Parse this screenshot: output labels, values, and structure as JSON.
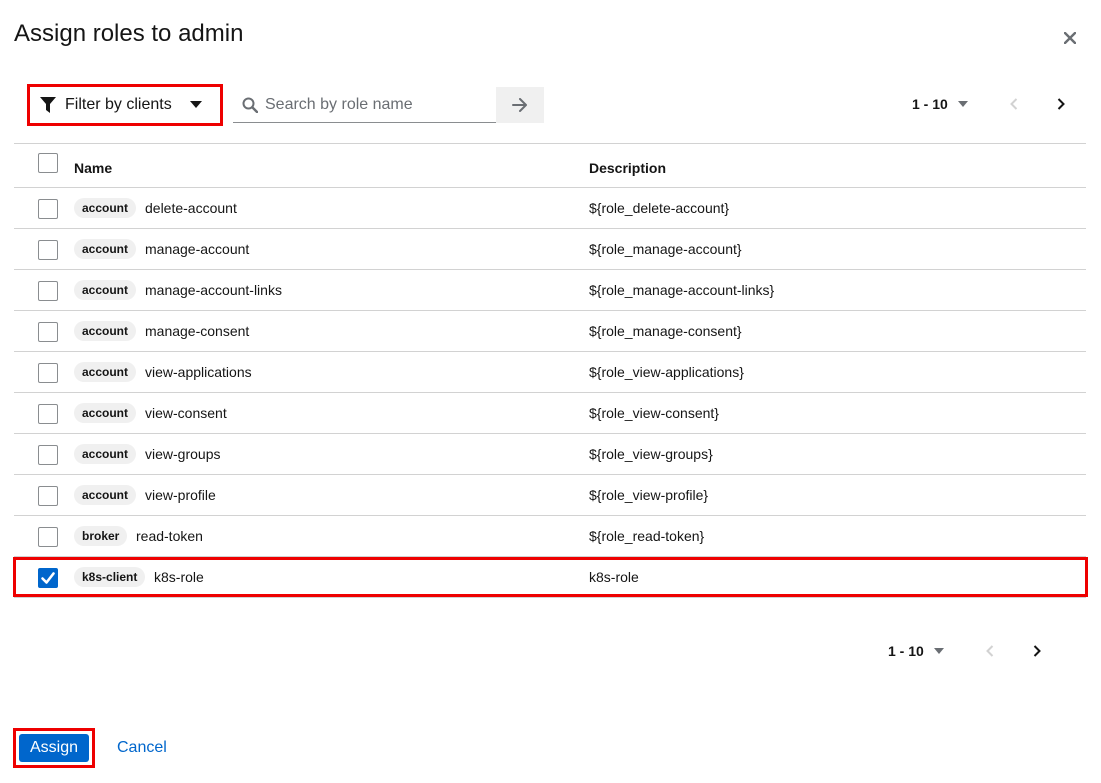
{
  "modal": {
    "title": "Assign roles to admin"
  },
  "toolbar": {
    "filter_label": "Filter by clients",
    "search_placeholder": "Search by role name",
    "pagination_range": "1 - 10"
  },
  "table": {
    "columns": [
      "Name",
      "Description"
    ],
    "rows": [
      {
        "client": "account",
        "name": "delete-account",
        "description": "${role_delete-account}",
        "checked": false
      },
      {
        "client": "account",
        "name": "manage-account",
        "description": "${role_manage-account}",
        "checked": false
      },
      {
        "client": "account",
        "name": "manage-account-links",
        "description": "${role_manage-account-links}",
        "checked": false
      },
      {
        "client": "account",
        "name": "manage-consent",
        "description": "${role_manage-consent}",
        "checked": false
      },
      {
        "client": "account",
        "name": "view-applications",
        "description": "${role_view-applications}",
        "checked": false
      },
      {
        "client": "account",
        "name": "view-consent",
        "description": "${role_view-consent}",
        "checked": false
      },
      {
        "client": "account",
        "name": "view-groups",
        "description": "${role_view-groups}",
        "checked": false
      },
      {
        "client": "account",
        "name": "view-profile",
        "description": "${role_view-profile}",
        "checked": false
      },
      {
        "client": "broker",
        "name": "read-token",
        "description": "${role_read-token}",
        "checked": false
      },
      {
        "client": "k8s-client",
        "name": "k8s-role",
        "description": "k8s-role",
        "checked": true
      }
    ]
  },
  "footer": {
    "pagination_range": "1 - 10",
    "assign_label": "Assign",
    "cancel_label": "Cancel"
  },
  "colors": {
    "primary": "#0066cc",
    "highlight": "#ee0000",
    "badge_bg": "#f0f0f0"
  },
  "icons": {
    "filter": "filter-icon",
    "search": "search-icon",
    "go": "arrow-right-icon",
    "close": "close-icon"
  }
}
